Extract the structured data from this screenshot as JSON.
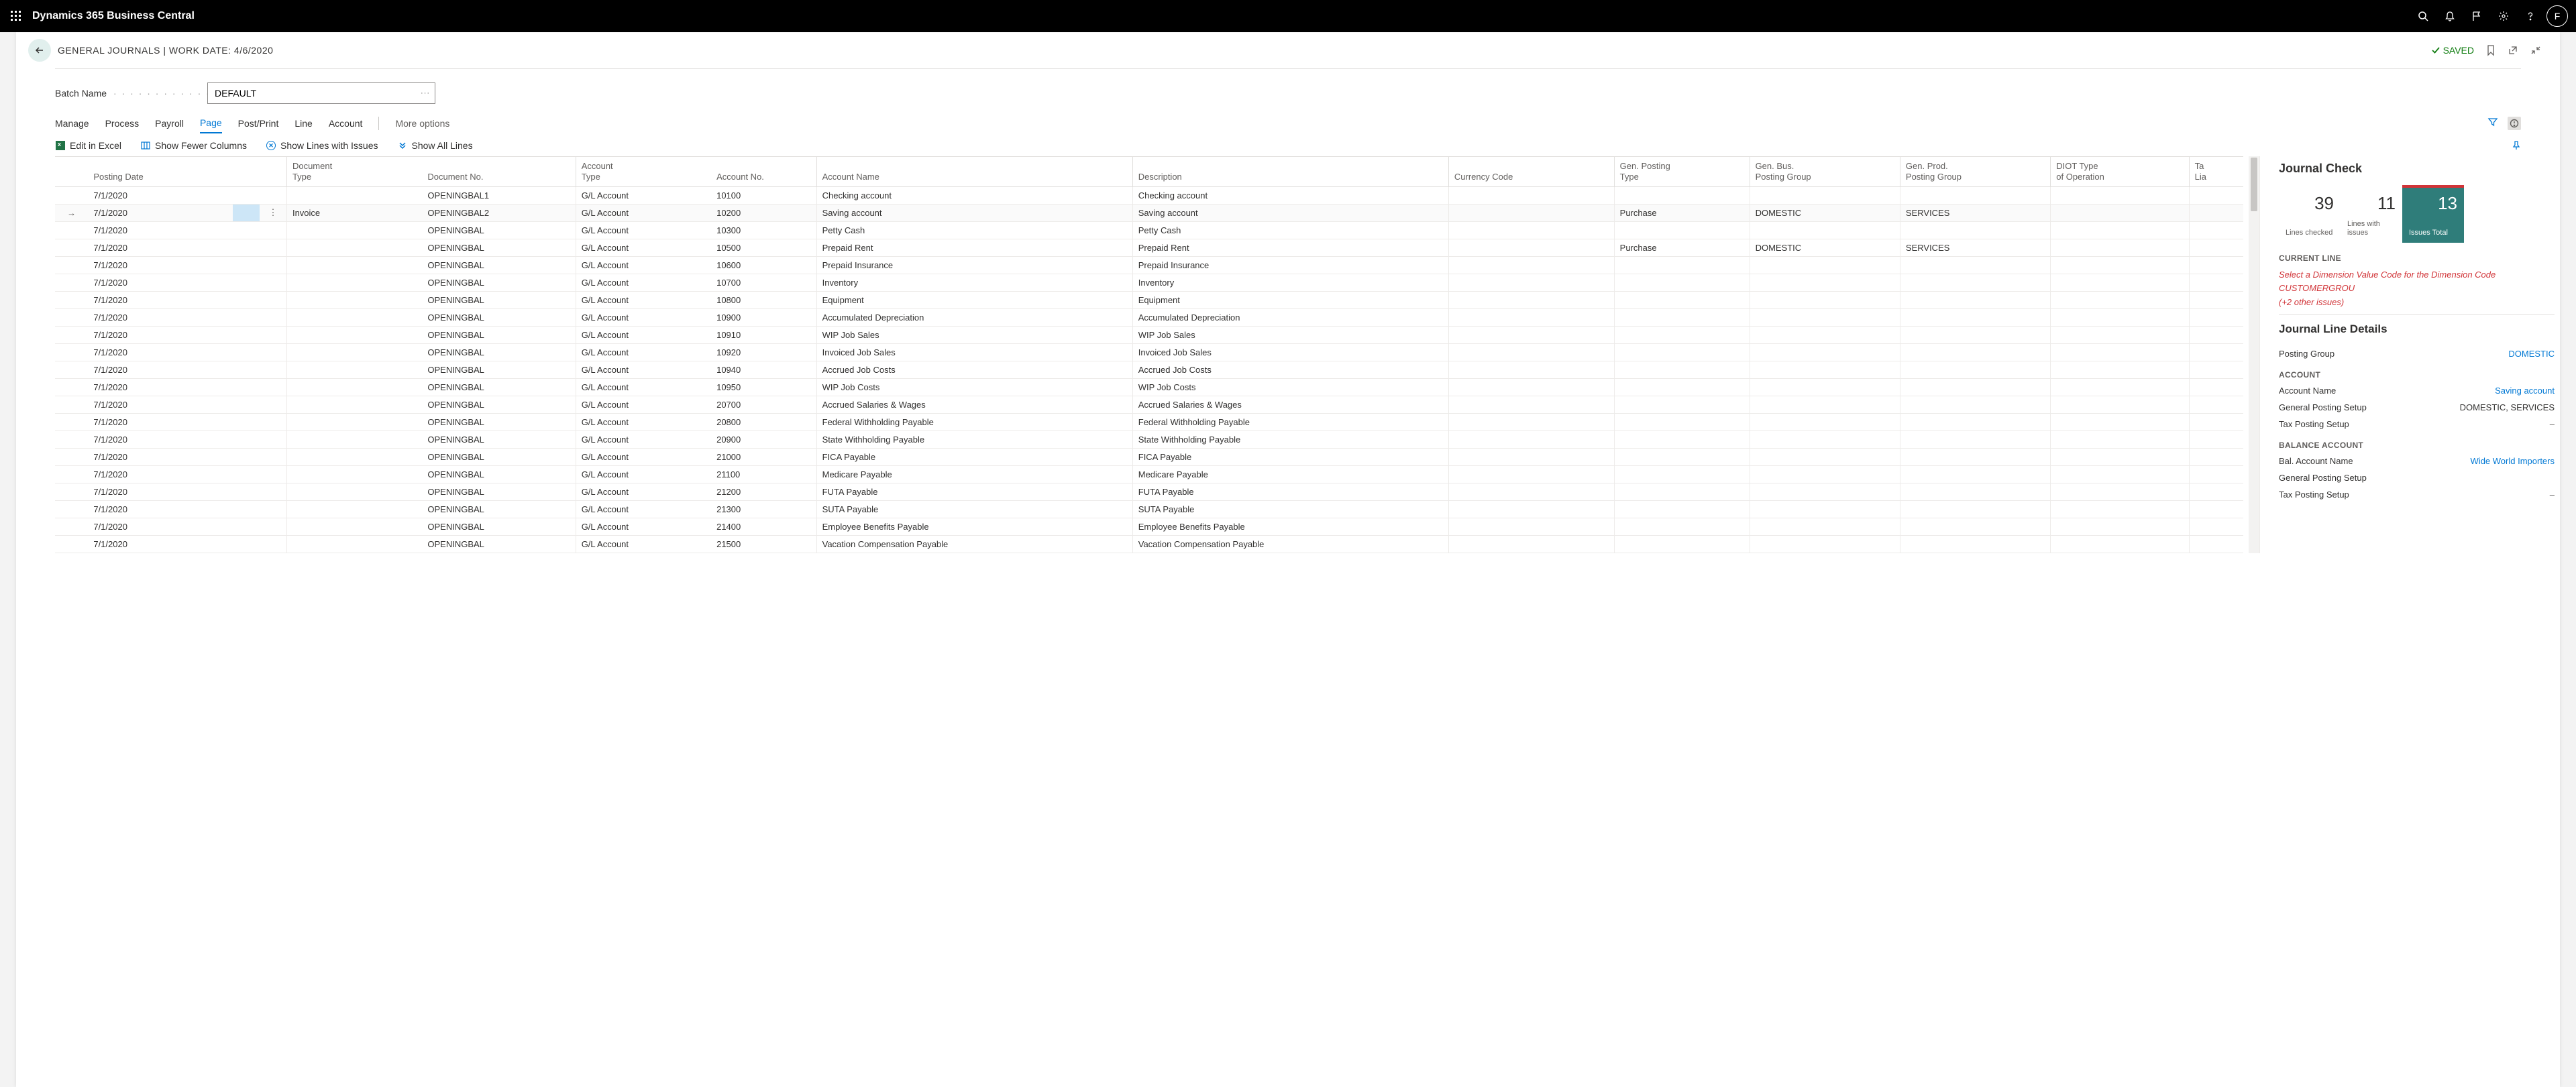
{
  "app": {
    "name": "Dynamics 365 Business Central",
    "user_initial": "F"
  },
  "page": {
    "breadcrumb_main": "GENERAL JOURNALS",
    "breadcrumb_sep": " | ",
    "workdate_label": "WORK DATE: ",
    "workdate": "4/6/2020",
    "saved": "SAVED"
  },
  "batch": {
    "label": "Batch Name",
    "value": "DEFAULT"
  },
  "menu": {
    "items": [
      "Manage",
      "Process",
      "Payroll",
      "Page",
      "Post/Print",
      "Line",
      "Account"
    ],
    "active_index": 3,
    "more": "More options"
  },
  "actions": {
    "edit_excel": "Edit in Excel",
    "fewer_cols": "Show Fewer Columns",
    "lines_issues": "Show Lines with Issues",
    "show_all": "Show All Lines"
  },
  "grid": {
    "columns": [
      "Posting Date",
      "Document Type",
      "Document No.",
      "Account Type",
      "Account No.",
      "Account Name",
      "Description",
      "Currency Code",
      "Gen. Posting Type",
      "Gen. Bus. Posting Group",
      "Gen. Prod. Posting Group",
      "DIOT Type of Operation",
      "Tax Lia"
    ],
    "selected_row": 1,
    "rows": [
      {
        "date": "7/1/2020",
        "doctype": "",
        "docno": "OPENINGBAL1",
        "acctype": "G/L Account",
        "accno": "10100",
        "accname": "Checking account",
        "desc": "Checking account",
        "cur": "",
        "gpt": "",
        "gbpg": "",
        "gppg": "",
        "diot": ""
      },
      {
        "date": "7/1/2020",
        "doctype": "Invoice",
        "docno": "OPENINGBAL2",
        "acctype": "G/L Account",
        "accno": "10200",
        "accname": "Saving account",
        "desc": "Saving account",
        "cur": "",
        "gpt": "Purchase",
        "gbpg": "DOMESTIC",
        "gppg": "SERVICES",
        "diot": ""
      },
      {
        "date": "7/1/2020",
        "doctype": "",
        "docno": "OPENINGBAL",
        "acctype": "G/L Account",
        "accno": "10300",
        "accname": "Petty Cash",
        "desc": "Petty Cash",
        "cur": "",
        "gpt": "",
        "gbpg": "",
        "gppg": "",
        "diot": ""
      },
      {
        "date": "7/1/2020",
        "doctype": "",
        "docno": "OPENINGBAL",
        "acctype": "G/L Account",
        "accno": "10500",
        "accname": "Prepaid Rent",
        "desc": "Prepaid Rent",
        "cur": "",
        "gpt": "Purchase",
        "gbpg": "DOMESTIC",
        "gppg": "SERVICES",
        "diot": ""
      },
      {
        "date": "7/1/2020",
        "doctype": "",
        "docno": "OPENINGBAL",
        "acctype": "G/L Account",
        "accno": "10600",
        "accname": "Prepaid Insurance",
        "desc": "Prepaid Insurance",
        "cur": "",
        "gpt": "",
        "gbpg": "",
        "gppg": "",
        "diot": ""
      },
      {
        "date": "7/1/2020",
        "doctype": "",
        "docno": "OPENINGBAL",
        "acctype": "G/L Account",
        "accno": "10700",
        "accname": "Inventory",
        "desc": "Inventory",
        "cur": "",
        "gpt": "",
        "gbpg": "",
        "gppg": "",
        "diot": ""
      },
      {
        "date": "7/1/2020",
        "doctype": "",
        "docno": "OPENINGBAL",
        "acctype": "G/L Account",
        "accno": "10800",
        "accname": "Equipment",
        "desc": "Equipment",
        "cur": "",
        "gpt": "",
        "gbpg": "",
        "gppg": "",
        "diot": ""
      },
      {
        "date": "7/1/2020",
        "doctype": "",
        "docno": "OPENINGBAL",
        "acctype": "G/L Account",
        "accno": "10900",
        "accname": "Accumulated Depreciation",
        "desc": "Accumulated Depreciation",
        "cur": "",
        "gpt": "",
        "gbpg": "",
        "gppg": "",
        "diot": ""
      },
      {
        "date": "7/1/2020",
        "doctype": "",
        "docno": "OPENINGBAL",
        "acctype": "G/L Account",
        "accno": "10910",
        "accname": "WIP Job Sales",
        "desc": "WIP Job Sales",
        "cur": "",
        "gpt": "",
        "gbpg": "",
        "gppg": "",
        "diot": ""
      },
      {
        "date": "7/1/2020",
        "doctype": "",
        "docno": "OPENINGBAL",
        "acctype": "G/L Account",
        "accno": "10920",
        "accname": "Invoiced Job Sales",
        "desc": "Invoiced Job Sales",
        "cur": "",
        "gpt": "",
        "gbpg": "",
        "gppg": "",
        "diot": ""
      },
      {
        "date": "7/1/2020",
        "doctype": "",
        "docno": "OPENINGBAL",
        "acctype": "G/L Account",
        "accno": "10940",
        "accname": "Accrued Job Costs",
        "desc": "Accrued Job Costs",
        "cur": "",
        "gpt": "",
        "gbpg": "",
        "gppg": "",
        "diot": ""
      },
      {
        "date": "7/1/2020",
        "doctype": "",
        "docno": "OPENINGBAL",
        "acctype": "G/L Account",
        "accno": "10950",
        "accname": "WIP Job Costs",
        "desc": "WIP Job Costs",
        "cur": "",
        "gpt": "",
        "gbpg": "",
        "gppg": "",
        "diot": ""
      },
      {
        "date": "7/1/2020",
        "doctype": "",
        "docno": "OPENINGBAL",
        "acctype": "G/L Account",
        "accno": "20700",
        "accname": "Accrued Salaries & Wages",
        "desc": "Accrued Salaries & Wages",
        "cur": "",
        "gpt": "",
        "gbpg": "",
        "gppg": "",
        "diot": ""
      },
      {
        "date": "7/1/2020",
        "doctype": "",
        "docno": "OPENINGBAL",
        "acctype": "G/L Account",
        "accno": "20800",
        "accname": "Federal Withholding Payable",
        "desc": "Federal Withholding Payable",
        "cur": "",
        "gpt": "",
        "gbpg": "",
        "gppg": "",
        "diot": ""
      },
      {
        "date": "7/1/2020",
        "doctype": "",
        "docno": "OPENINGBAL",
        "acctype": "G/L Account",
        "accno": "20900",
        "accname": "State Withholding Payable",
        "desc": "State Withholding Payable",
        "cur": "",
        "gpt": "",
        "gbpg": "",
        "gppg": "",
        "diot": ""
      },
      {
        "date": "7/1/2020",
        "doctype": "",
        "docno": "OPENINGBAL",
        "acctype": "G/L Account",
        "accno": "21000",
        "accname": "FICA Payable",
        "desc": "FICA Payable",
        "cur": "",
        "gpt": "",
        "gbpg": "",
        "gppg": "",
        "diot": ""
      },
      {
        "date": "7/1/2020",
        "doctype": "",
        "docno": "OPENINGBAL",
        "acctype": "G/L Account",
        "accno": "21100",
        "accname": "Medicare Payable",
        "desc": "Medicare Payable",
        "cur": "",
        "gpt": "",
        "gbpg": "",
        "gppg": "",
        "diot": ""
      },
      {
        "date": "7/1/2020",
        "doctype": "",
        "docno": "OPENINGBAL",
        "acctype": "G/L Account",
        "accno": "21200",
        "accname": "FUTA Payable",
        "desc": "FUTA Payable",
        "cur": "",
        "gpt": "",
        "gbpg": "",
        "gppg": "",
        "diot": ""
      },
      {
        "date": "7/1/2020",
        "doctype": "",
        "docno": "OPENINGBAL",
        "acctype": "G/L Account",
        "accno": "21300",
        "accname": "SUTA Payable",
        "desc": "SUTA Payable",
        "cur": "",
        "gpt": "",
        "gbpg": "",
        "gppg": "",
        "diot": ""
      },
      {
        "date": "7/1/2020",
        "doctype": "",
        "docno": "OPENINGBAL",
        "acctype": "G/L Account",
        "accno": "21400",
        "accname": "Employee Benefits Payable",
        "desc": "Employee Benefits Payable",
        "cur": "",
        "gpt": "",
        "gbpg": "",
        "gppg": "",
        "diot": ""
      },
      {
        "date": "7/1/2020",
        "doctype": "",
        "docno": "OPENINGBAL",
        "acctype": "G/L Account",
        "accno": "21500",
        "accname": "Vacation Compensation Payable",
        "desc": "Vacation Compensation Payable",
        "cur": "",
        "gpt": "",
        "gbpg": "",
        "gppg": "",
        "diot": ""
      }
    ]
  },
  "check": {
    "title": "Journal Check",
    "tiles": [
      {
        "num": "39",
        "label": "Lines checked"
      },
      {
        "num": "11",
        "label": "Lines with issues"
      },
      {
        "num": "13",
        "label": "Issues Total"
      }
    ],
    "active_tile": 2,
    "current_line_label": "CURRENT LINE",
    "error_text": "Select a Dimension Value Code for the Dimension Code CUSTOMERGROU",
    "error_more": "(+2 other issues)",
    "details_title": "Journal Line Details",
    "posting_group_label": "Posting Group",
    "posting_group_value": "DOMESTIC",
    "account_section": "ACCOUNT",
    "account_name_label": "Account Name",
    "account_name_value": "Saving account",
    "gps_label": "General Posting Setup",
    "gps_value": "DOMESTIC, SERVICES",
    "tps_label": "Tax Posting Setup",
    "tps_value": "–",
    "bal_section": "BALANCE ACCOUNT",
    "bal_name_label": "Bal. Account Name",
    "bal_name_value": "Wide World Importers",
    "bal_gps_label": "General Posting Setup",
    "bal_tps_label": "Tax Posting Setup",
    "bal_tps_value": "–"
  }
}
